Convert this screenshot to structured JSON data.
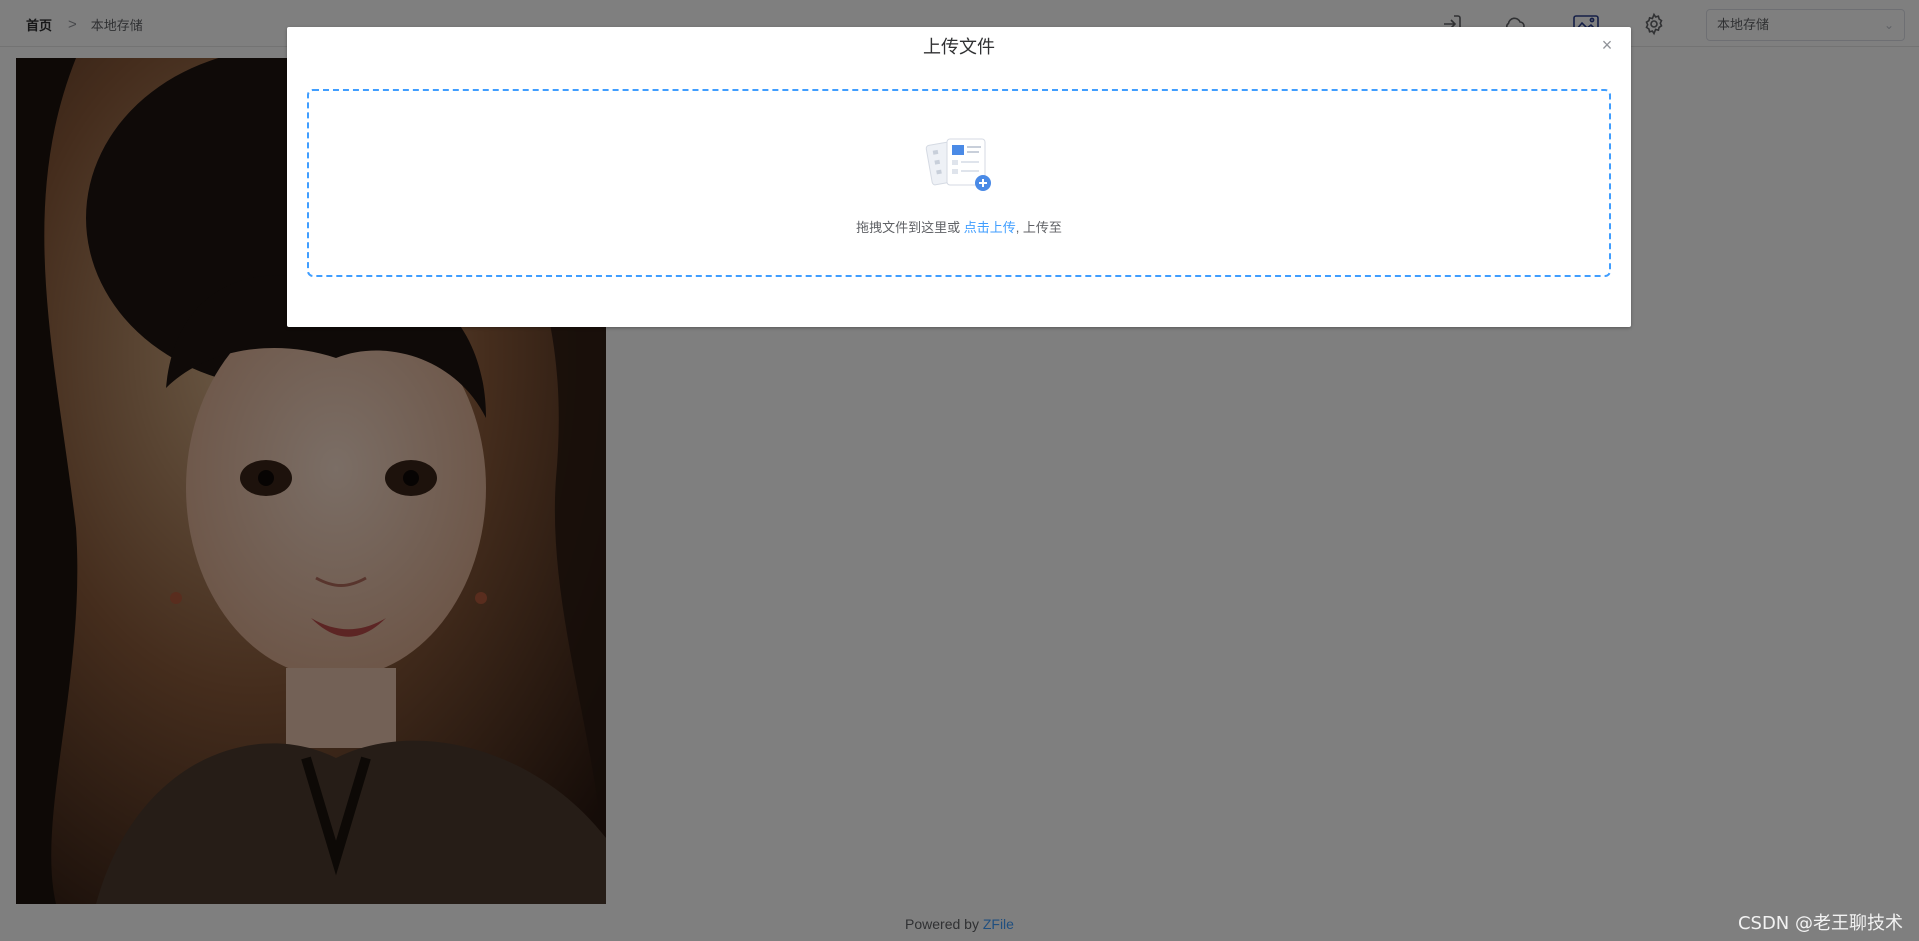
{
  "header": {
    "breadcrumb": {
      "home": "首页",
      "separator": ">",
      "current": "本地存储"
    },
    "toolbar_icons": [
      "login-icon",
      "cloud-icon",
      "gallery-icon",
      "gear-icon"
    ],
    "storage_select": {
      "value": "本地存储",
      "arrow": "⌄"
    }
  },
  "preview": {
    "icon": "image-preview"
  },
  "footer": {
    "prefix": "Powered by ",
    "brand": "ZFile"
  },
  "dialog": {
    "title": "上传文件",
    "close": "×",
    "dropzone": {
      "text_before": "拖拽文件到这里或 ",
      "link": "点击上传",
      "text_after": ", 上传至"
    }
  },
  "watermark": "CSDN @老王聊技术",
  "colors": {
    "accent": "#409eff",
    "mask": "rgba(0,0,0,0.5)"
  }
}
